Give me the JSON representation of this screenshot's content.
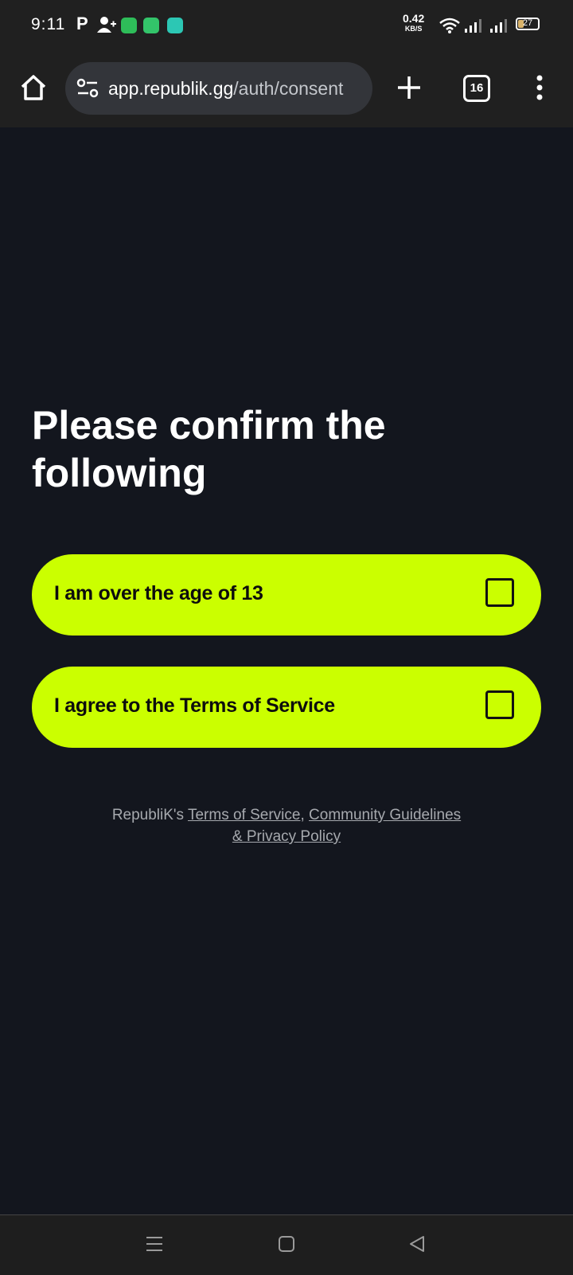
{
  "status_bar": {
    "time": "9:11",
    "net_speed_value": "0.42",
    "net_speed_unit": "KB/S",
    "battery": "27",
    "icons": [
      "p-notification-icon",
      "add-user-icon",
      "app-icon-green",
      "messages-icon",
      "chat-icon",
      "wifi-icon",
      "signal-icon",
      "signal-icon",
      "battery-icon"
    ]
  },
  "browser": {
    "url_host": "app.republik.gg",
    "url_path": "/auth/consent",
    "tab_count": "16"
  },
  "page": {
    "title": "Please confirm the following",
    "options": [
      {
        "label": "I am over the age of 13",
        "checked": false
      },
      {
        "label": "I agree to the Terms of Service",
        "checked": false
      }
    ],
    "legal": {
      "prefix": "RepubliK's ",
      "terms_link": "Terms of Service",
      "separator": ", ",
      "guidelines_link": "Community Guidelines",
      "privacy_link": "& Privacy Policy"
    }
  },
  "colors": {
    "accent": "#cbff00",
    "background": "#13161e",
    "bar": "#202020"
  }
}
